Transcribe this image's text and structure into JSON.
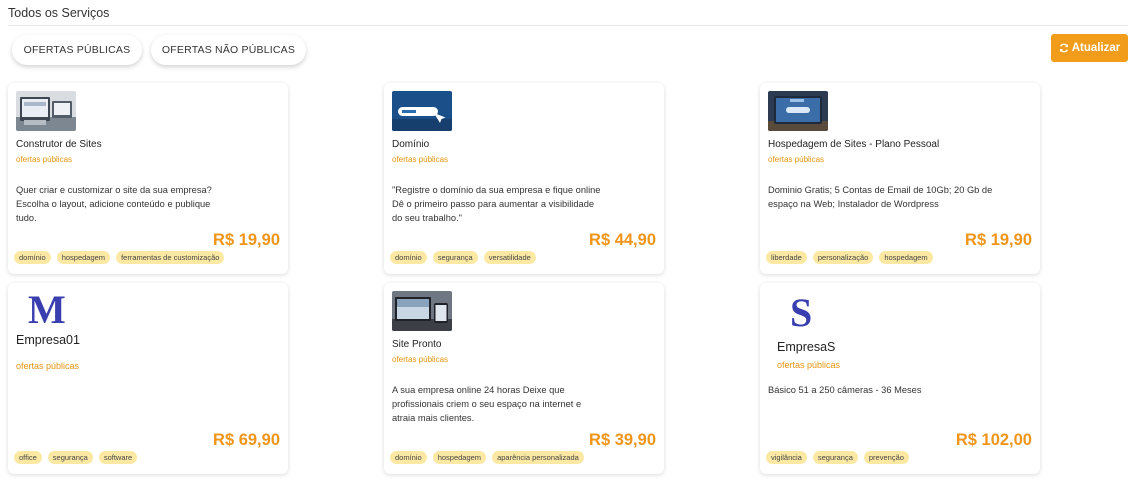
{
  "page": {
    "title": "Todos os Serviços"
  },
  "filters": {
    "public_label": "OFERTAS PÚBLICAS",
    "nonpublic_label": "OFERTAS NÃO PÚBLICAS"
  },
  "toolbar": {
    "refresh_label": "Atualizar",
    "refresh_icon": "refresh-icon",
    "accent_color": "#f19c1b"
  },
  "cards": [
    {
      "name": "Construtor de Sites",
      "subtitle": "ofertas públicas",
      "description": "Quer criar e customizar o site da sua empresa? Escolha o layout, adicione conteúdo e publique tudo.",
      "price": "R$ 19,90",
      "tags": [
        "domínio",
        "hospedagem",
        "ferramentas de customização"
      ]
    },
    {
      "name": "Domínio",
      "subtitle": "ofertas públicas",
      "description": "\"Registre o domínio da sua empresa e fique online Dê o primeiro passo para aumentar a visibilidade do seu trabalho.\"",
      "price": "R$ 44,90",
      "tags": [
        "domínio",
        "segurança",
        "versatilidade"
      ]
    },
    {
      "name": "Hospedagem de Sites - Plano Pessoal",
      "subtitle": "ofertas públicas",
      "description": "Dominio Gratis; 5 Contas de Email de 10Gb; 20 Gb de espaço na Web; Instalador de Wordpress",
      "price": "R$ 19,90",
      "tags": [
        "liberdade",
        "personalização",
        "hospedagem"
      ]
    },
    {
      "name": "Empresa01",
      "subtitle": "ofertas públicas",
      "logo_letter": "M",
      "description": "",
      "price": "R$ 69,90",
      "tags": [
        "office",
        "segurança",
        "software"
      ]
    },
    {
      "name": "Site Pronto",
      "subtitle": "ofertas públicas",
      "description": "A sua empresa online 24 horas Deixe que profissionais criem o seu espaço na internet e atraia mais clientes.",
      "price": "R$ 39,90",
      "tags": [
        "domínio",
        "hospedagem",
        "aparência personalizada"
      ]
    },
    {
      "name": "EmpresaS",
      "subtitle": "ofertas públicas",
      "logo_letter": "S",
      "description": "Básico 51 a 250 câmeras - 36 Meses",
      "price": "R$ 102,00",
      "tags": [
        "vigilância",
        "segurança",
        "prevenção"
      ]
    }
  ]
}
